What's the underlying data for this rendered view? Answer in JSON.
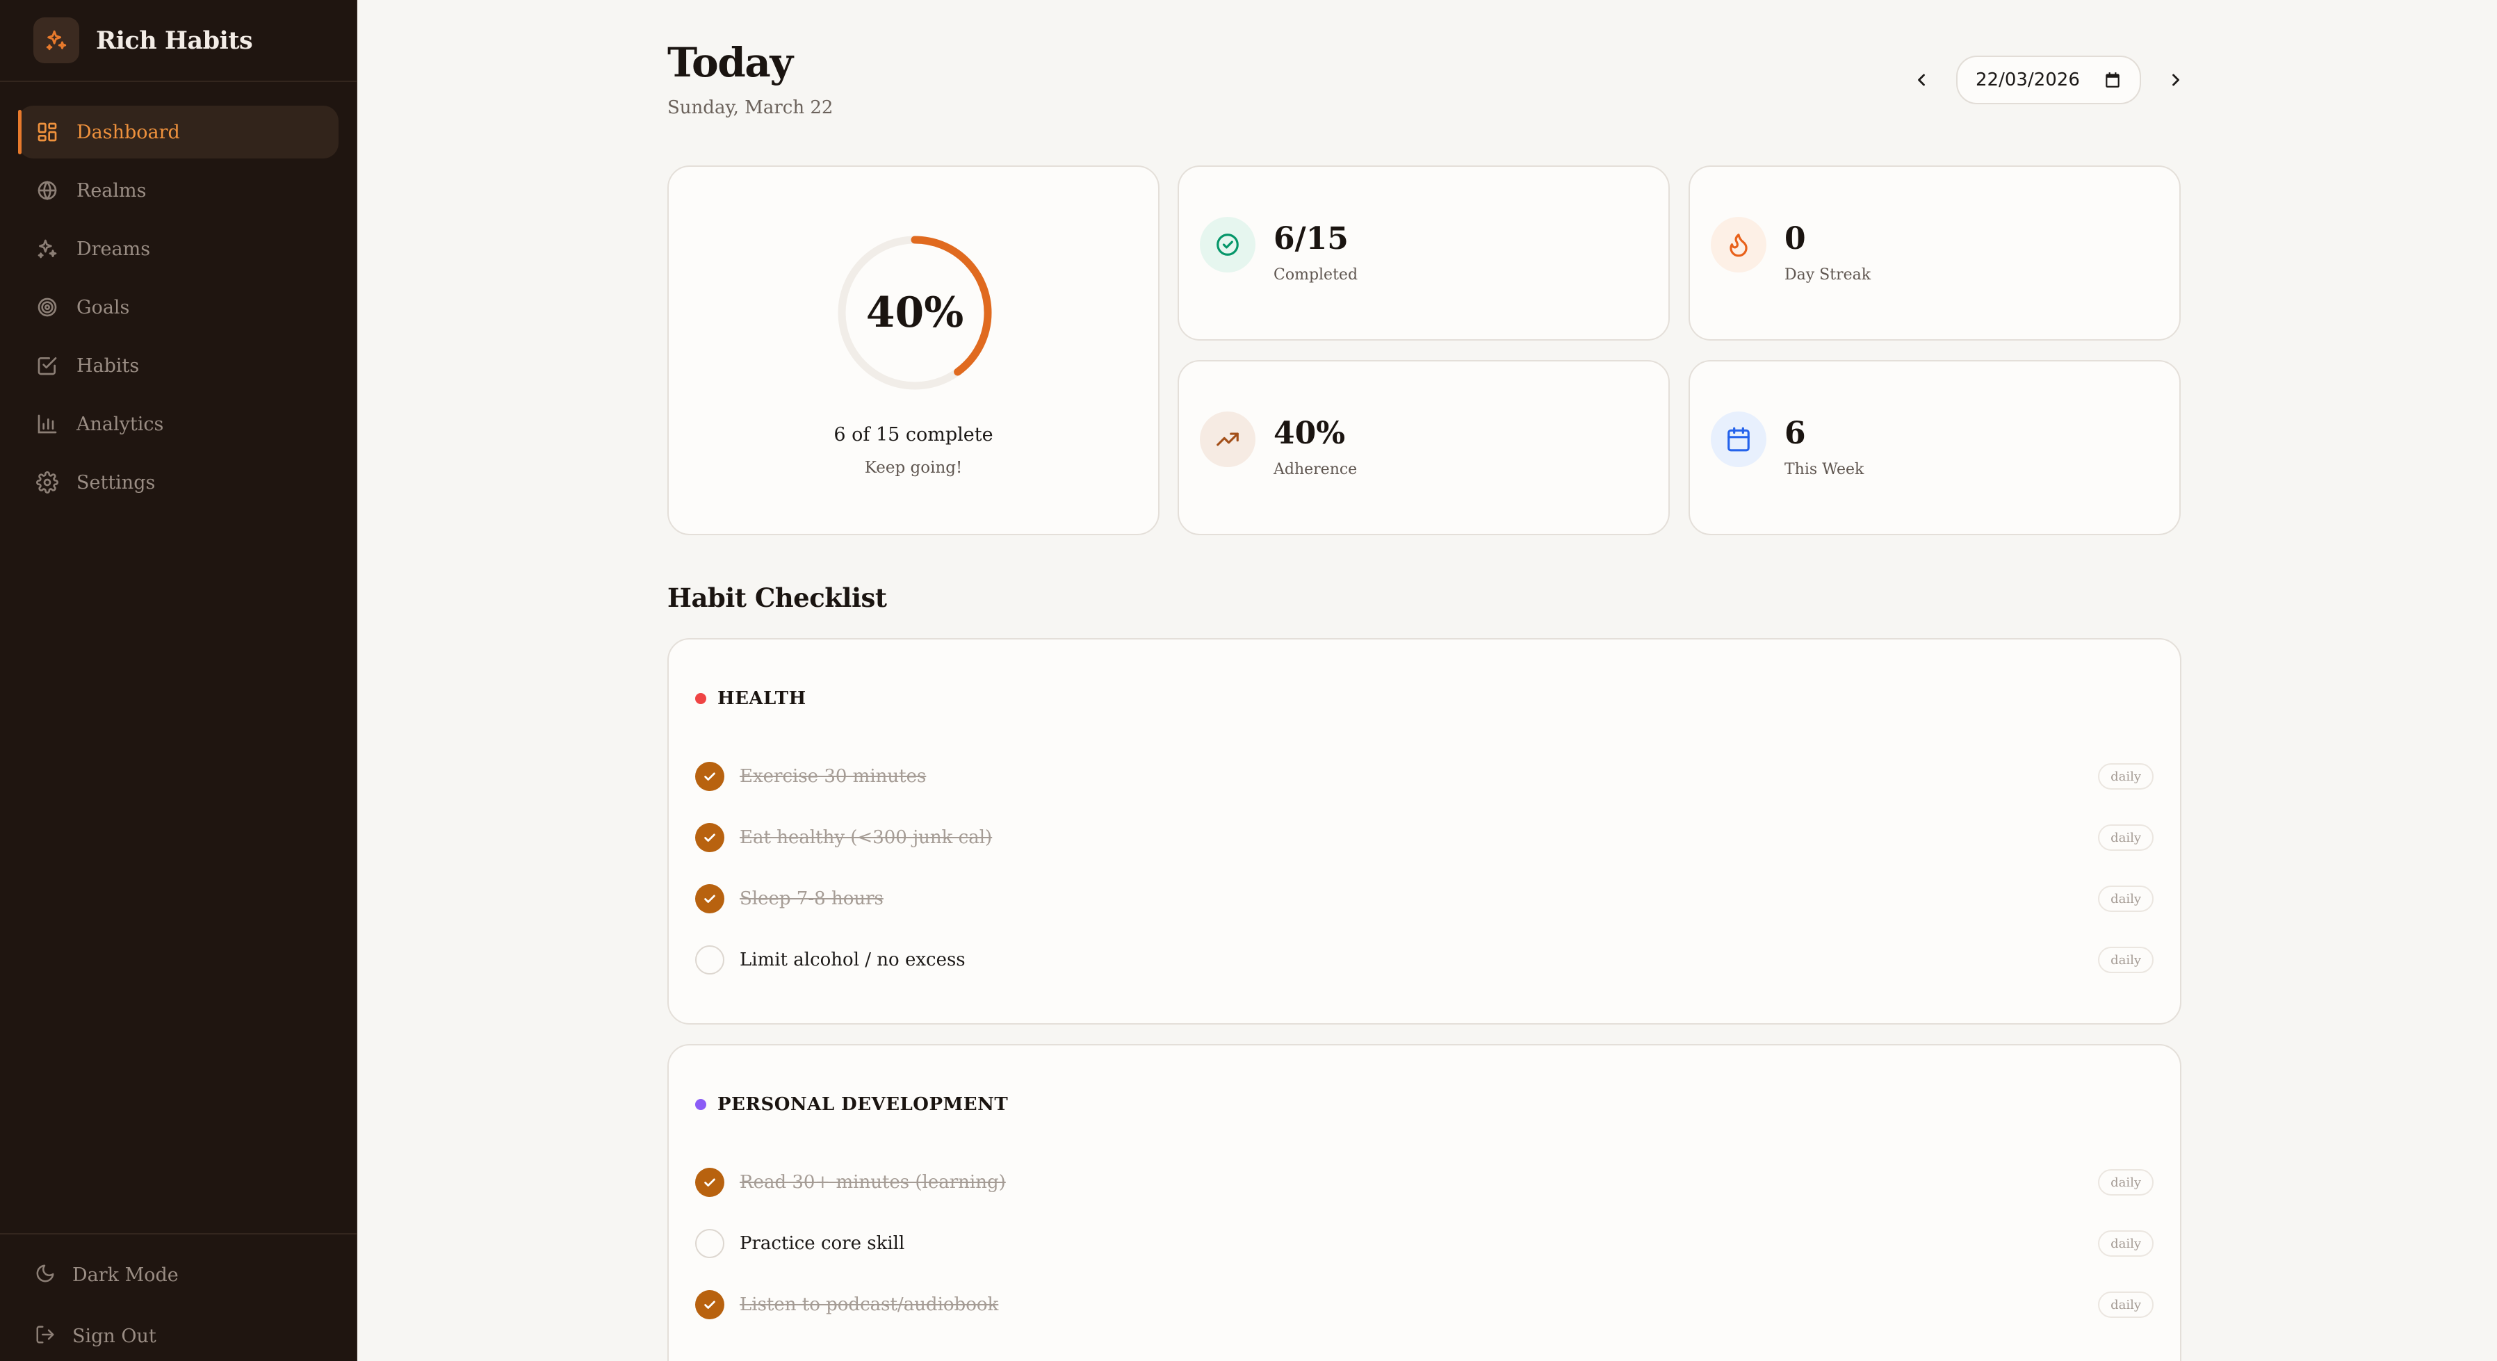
{
  "app": {
    "name": "Rich Habits"
  },
  "sidebar": {
    "items": [
      {
        "label": "Dashboard",
        "icon": "dashboard-icon",
        "active": true
      },
      {
        "label": "Realms",
        "icon": "globe-icon"
      },
      {
        "label": "Dreams",
        "icon": "sparkles-icon"
      },
      {
        "label": "Goals",
        "icon": "target-icon"
      },
      {
        "label": "Habits",
        "icon": "checkbox-icon"
      },
      {
        "label": "Analytics",
        "icon": "bar-chart-icon"
      },
      {
        "label": "Settings",
        "icon": "gear-icon"
      }
    ],
    "bottom": {
      "dark_mode": "Dark Mode",
      "sign_out": "Sign Out"
    }
  },
  "header": {
    "title": "Today",
    "subtitle": "Sunday, March 22",
    "date_value": "22/03/2026"
  },
  "progress": {
    "percent_label": "40%",
    "fraction": 0.4,
    "summary": "6 of 15 complete",
    "encouragement": "Keep going!"
  },
  "stats": {
    "completed": {
      "value": "6/15",
      "label": "Completed",
      "icon": "check-circle-icon"
    },
    "streak": {
      "value": "0",
      "label": "Day Streak",
      "icon": "flame-icon"
    },
    "adherence": {
      "value": "40%",
      "label": "Adherence",
      "icon": "trending-up-icon"
    },
    "week": {
      "value": "6",
      "label": "This Week",
      "icon": "calendar-icon"
    }
  },
  "checklist": {
    "title": "Habit Checklist",
    "groups": [
      {
        "name": "HEALTH",
        "color": "#ef4444",
        "habits": [
          {
            "name": "Exercise 30 minutes",
            "frequency": "daily",
            "done": true
          },
          {
            "name": "Eat healthy (<300 junk cal)",
            "frequency": "daily",
            "done": true
          },
          {
            "name": "Sleep 7-8 hours",
            "frequency": "daily",
            "done": true
          },
          {
            "name": "Limit alcohol / no excess",
            "frequency": "daily",
            "done": false
          }
        ]
      },
      {
        "name": "PERSONAL DEVELOPMENT",
        "color": "#8b5cf6",
        "habits": [
          {
            "name": "Read 30+ minutes (learning)",
            "frequency": "daily",
            "done": true
          },
          {
            "name": "Practice core skill",
            "frequency": "daily",
            "done": false
          },
          {
            "name": "Listen to podcast/audiobook",
            "frequency": "daily",
            "done": true
          }
        ]
      }
    ]
  },
  "colors": {
    "accent": "#e87a2c",
    "check": "#b8620f",
    "sidebar_bg": "#1f1510",
    "page_bg": "#f7f6f3"
  }
}
